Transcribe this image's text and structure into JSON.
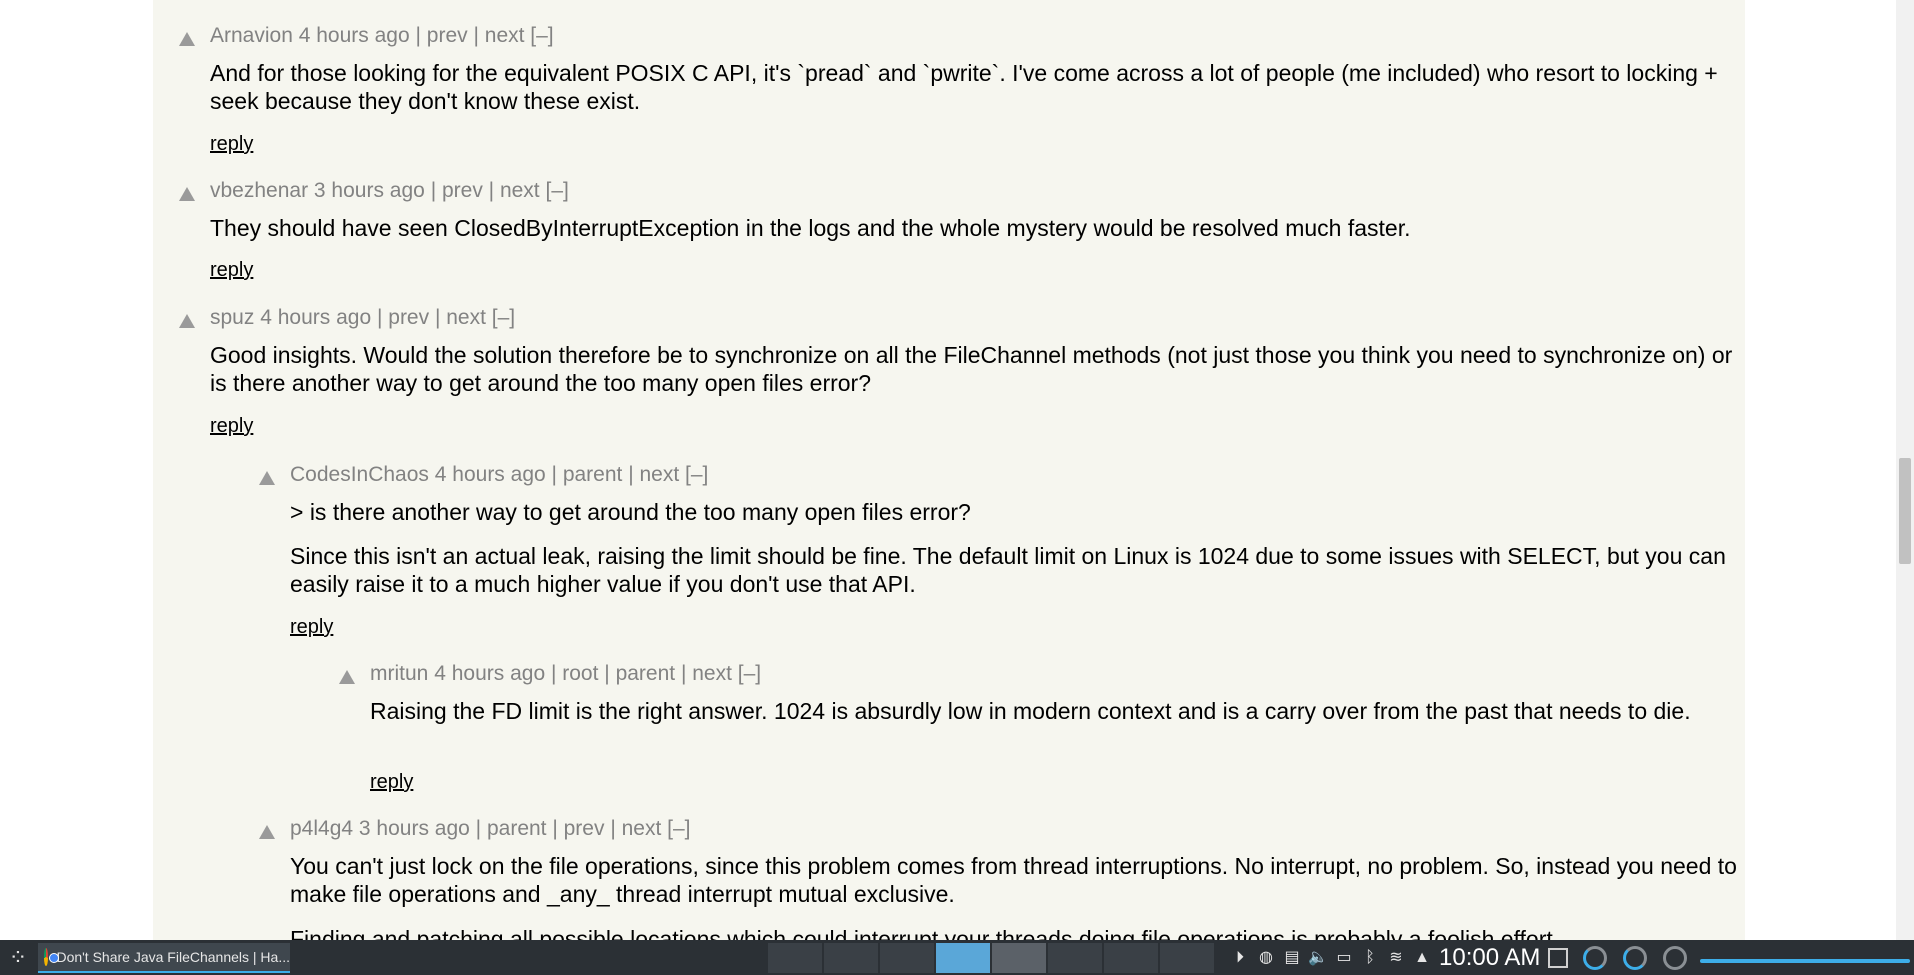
{
  "comments": [
    {
      "user": "Arnavion",
      "age": "4 hours ago",
      "nav": "| prev | next [–]",
      "paragraphs": [
        "And for those looking for the equivalent POSIX C API, it's `pread` and `pwrite`. I've come across a lot of people (me included) who resort to locking + seek because they don't know these exist."
      ],
      "reply": "reply"
    },
    {
      "user": "vbezhenar",
      "age": "3 hours ago",
      "nav": "| prev | next [–]",
      "paragraphs": [
        "They should have seen ClosedByInterruptException in the logs and the whole mystery would be resolved much faster."
      ],
      "reply": "reply"
    },
    {
      "user": "spuz",
      "age": "4 hours ago",
      "nav": "| prev | next [–]",
      "paragraphs": [
        "Good insights. Would the solution therefore be to synchronize on all the FileChannel methods (not just those you think you need to synchronize on) or is there another way to get around the too many open files error?"
      ],
      "reply": "reply"
    },
    {
      "user": "CodesInChaos",
      "age": "4 hours ago",
      "nav": "| parent | next [–]",
      "paragraphs": [
        "> is there another way to get around the too many open files error?",
        "Since this isn't an actual leak, raising the limit should be fine. The default limit on Linux is 1024 due to some issues with SELECT, but you can easily raise it to a much higher value if you don't use that API."
      ],
      "reply": "reply"
    },
    {
      "user": "mritun",
      "age": "4 hours ago",
      "nav": "| root | parent | next [–]",
      "paragraphs": [
        "Raising the FD limit is the right answer. 1024 is absurdly low in modern context and is a carry over from the past that needs to die."
      ],
      "reply": "reply"
    },
    {
      "user": "p4l4g4",
      "age": "3 hours ago",
      "nav": "| parent | prev | next [–]",
      "paragraphs": [
        "You can't just lock on the file operations, since this problem comes from thread interruptions. No interrupt, no problem. So, instead you need to make file operations and _any_ thread interrupt mutual exclusive.",
        "Finding and patching all possible locations which could interrupt your threads doing file operations is probably a foolish effort."
      ]
    }
  ],
  "taskbar": {
    "task_label": "Don't Share Java FileChannels | Ha...",
    "clock": "10:00 AM"
  }
}
